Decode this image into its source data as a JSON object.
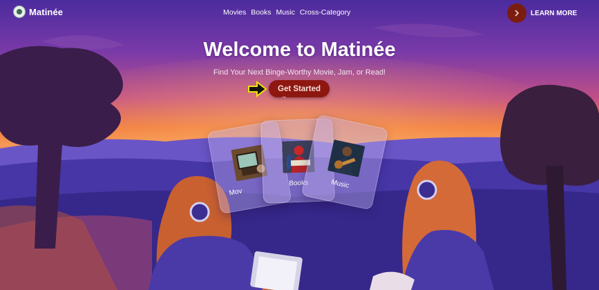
{
  "brand": {
    "name": "Matinée"
  },
  "nav": {
    "links": [
      "Movies",
      "Books",
      "Music",
      "Cross-Category"
    ]
  },
  "learn_more": {
    "label": "LEARN MORE",
    "icon": "chevron-right-icon"
  },
  "hero": {
    "title": "Welcome to Matinée",
    "subtitle": "Find Your Next Binge-Worthy Movie, Jam, or Read!",
    "cta_label": "Get Started",
    "cta_arrow": "→"
  },
  "cards": [
    {
      "label": "Movies",
      "visible_label": "Mov",
      "icon": "movie-thumbnail"
    },
    {
      "label": "Books",
      "icon": "books-thumbnail"
    },
    {
      "label": "Music",
      "icon": "music-thumbnail"
    }
  ],
  "colors": {
    "accent": "#8e1710",
    "sky_top": "#4a2a9a",
    "sky_glow": "#f07a3a",
    "hills": "#3a2c8c"
  }
}
